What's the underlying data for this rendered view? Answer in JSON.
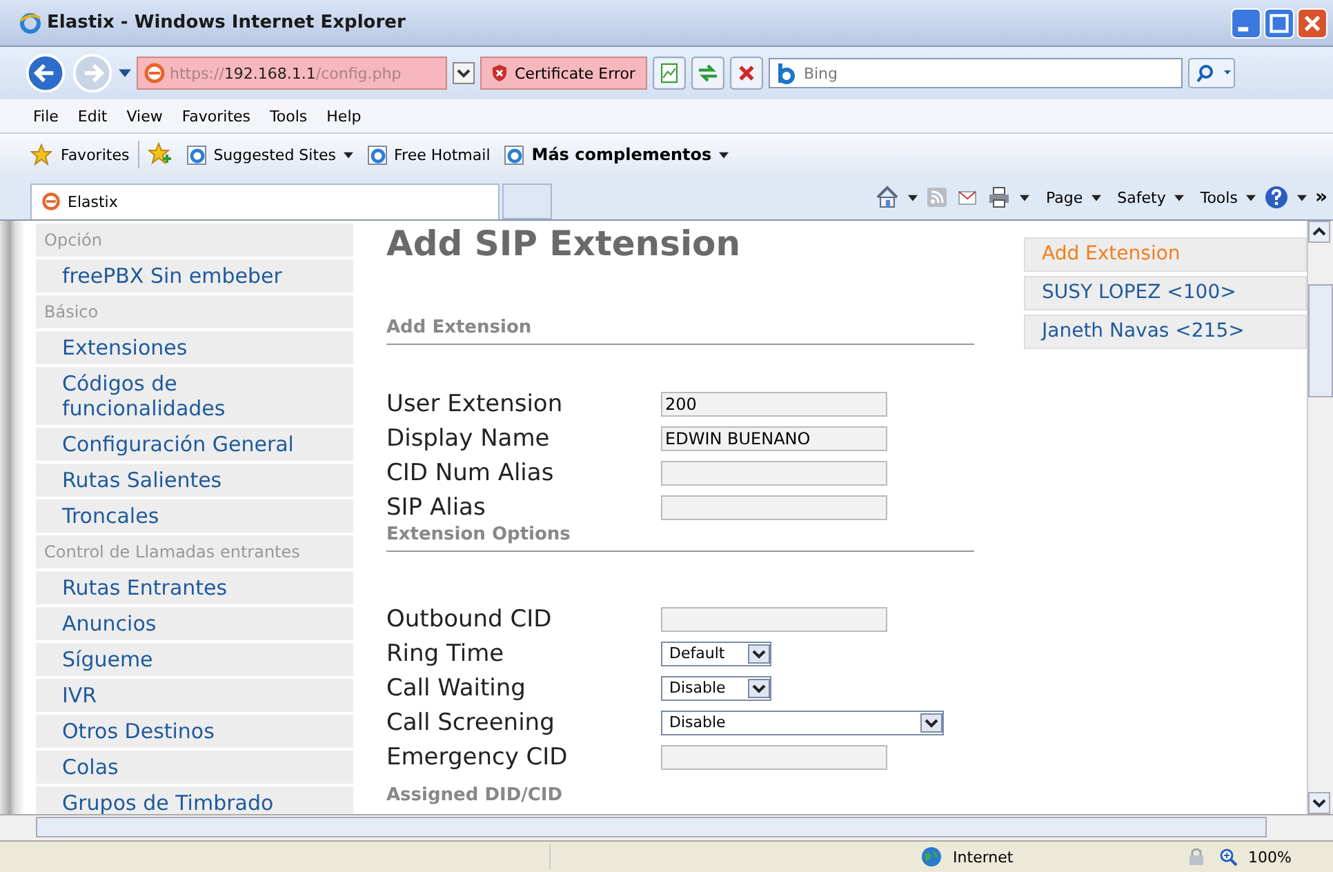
{
  "window": {
    "title": "Elastix - Windows Internet Explorer"
  },
  "address_bar": {
    "url_scheme": "https://",
    "url_host": "192.168.1.1",
    "url_path": "/config.php",
    "certificate_error": "Certificate Error"
  },
  "search": {
    "placeholder": "Bing"
  },
  "menu": [
    "File",
    "Edit",
    "View",
    "Favorites",
    "Tools",
    "Help"
  ],
  "favorites_bar": {
    "favorites": "Favorites",
    "links": [
      {
        "label": "Suggested Sites",
        "dropdown": true,
        "bold": false
      },
      {
        "label": "Free Hotmail",
        "dropdown": false,
        "bold": false
      },
      {
        "label": "Más complementos",
        "dropdown": true,
        "bold": true
      }
    ]
  },
  "tabs": [
    {
      "label": "Elastix",
      "selected": true
    }
  ],
  "command_bar": {
    "menus": [
      "Page",
      "Safety",
      "Tools"
    ],
    "overflow": "»"
  },
  "sidebar": {
    "items": [
      {
        "kind": "heading",
        "label": "Opción"
      },
      {
        "kind": "link",
        "label": "freePBX Sin embeber"
      },
      {
        "kind": "heading",
        "label": "Básico"
      },
      {
        "kind": "link",
        "label": "Extensiones"
      },
      {
        "kind": "link",
        "label": "Códigos de funcionalidades"
      },
      {
        "kind": "link",
        "label": "Configuración General"
      },
      {
        "kind": "link",
        "label": "Rutas Salientes"
      },
      {
        "kind": "link",
        "label": "Troncales"
      },
      {
        "kind": "heading",
        "label": "Control de Llamadas entrantes"
      },
      {
        "kind": "link",
        "label": "Rutas Entrantes"
      },
      {
        "kind": "link",
        "label": "Anuncios"
      },
      {
        "kind": "link",
        "label": "Sígueme"
      },
      {
        "kind": "link",
        "label": "IVR"
      },
      {
        "kind": "link",
        "label": "Otros Destinos"
      },
      {
        "kind": "link",
        "label": "Colas"
      },
      {
        "kind": "link",
        "label": "Grupos de Timbrado"
      }
    ]
  },
  "page": {
    "title": "Add SIP Extension",
    "sections": [
      {
        "title": "Add Extension",
        "fields": [
          {
            "label": "User Extension",
            "kind": "text",
            "value": "200"
          },
          {
            "label": "Display Name",
            "kind": "text",
            "value": "EDWIN BUENANO"
          },
          {
            "label": "CID Num Alias",
            "kind": "text"
          },
          {
            "label": "SIP Alias",
            "kind": "text"
          }
        ]
      },
      {
        "title": "Extension Options",
        "fields": [
          {
            "label": "Outbound CID",
            "kind": "text"
          },
          {
            "label": "Ring Time",
            "kind": "select",
            "value": "Default"
          },
          {
            "label": "Call Waiting",
            "kind": "select",
            "value": "Disable"
          },
          {
            "label": "Call Screening",
            "kind": "wide_select",
            "value": "Disable"
          },
          {
            "label": "Emergency CID",
            "kind": "text"
          }
        ]
      },
      {
        "title": "Assigned DID/CID"
      }
    ]
  },
  "extension_list": [
    {
      "label": "Add Extension",
      "selected": true
    },
    {
      "label": "SUSY LOPEZ <100>",
      "selected": false
    },
    {
      "label": "Janeth Navas <215>",
      "selected": false
    }
  ],
  "status_bar": {
    "zone": "Internet",
    "zoom": "100%"
  }
}
